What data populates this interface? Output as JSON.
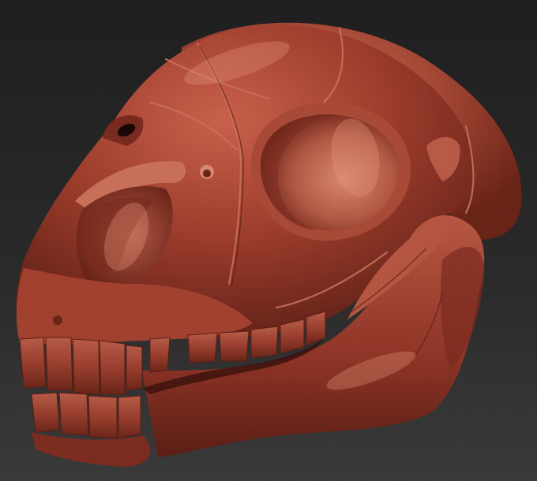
{
  "scene": {
    "subject": "sculpted-skull-render",
    "colors": {
      "background_top": "#1f1f1f",
      "background_bottom": "#3a3a3a",
      "material_base": "#8e3426",
      "material_light": "#c9614b",
      "material_highlight": "#e08a72",
      "material_shadow": "#4a1a12",
      "material_deep": "#2e0f0a"
    },
    "features": [
      "cranium",
      "orbit-left",
      "nasal-cavity",
      "zygomatic-arch",
      "mandible",
      "upper-teeth",
      "lower-teeth",
      "foramen-small",
      "temporal-ridge"
    ]
  }
}
